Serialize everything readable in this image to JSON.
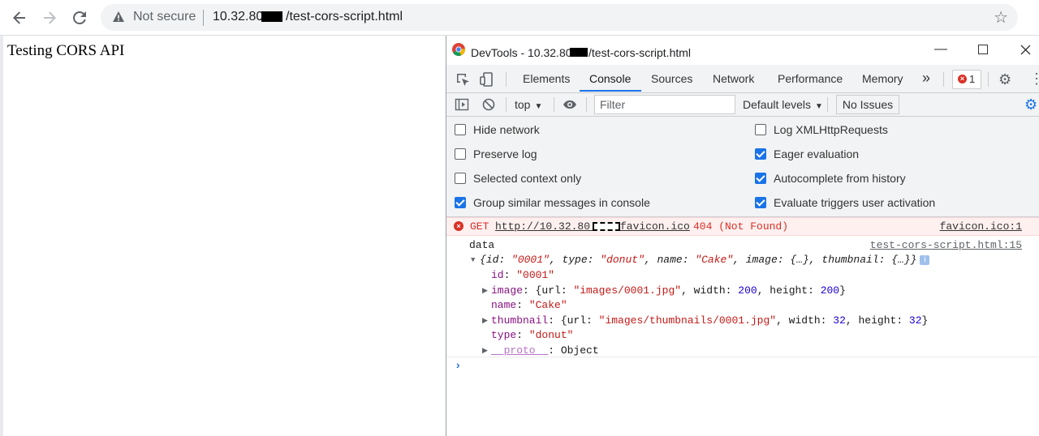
{
  "browser": {
    "security_label": "Not secure",
    "url_host": "10.32.80.",
    "url_path": "/test-cors-script.html"
  },
  "page": {
    "heading": "Testing CORS API"
  },
  "devtools": {
    "title_prefix": "DevTools - 10.32.80.",
    "title_suffix": "/test-cors-script.html",
    "tabs": [
      {
        "label": "Elements"
      },
      {
        "label": "Console"
      },
      {
        "label": "Sources"
      },
      {
        "label": "Network"
      },
      {
        "label": "Performance"
      },
      {
        "label": "Memory"
      }
    ],
    "active_tab": "Console",
    "error_count": "1",
    "toolbar": {
      "context": "top",
      "filter_placeholder": "Filter",
      "levels": "Default levels",
      "issues": "No Issues"
    },
    "settings": {
      "left": [
        {
          "label": "Hide network",
          "checked": false
        },
        {
          "label": "Preserve log",
          "checked": false
        },
        {
          "label": "Selected context only",
          "checked": false
        },
        {
          "label": "Group similar messages in console",
          "checked": true
        }
      ],
      "right": [
        {
          "label": "Log XMLHttpRequests",
          "checked": false
        },
        {
          "label": "Eager evaluation",
          "checked": true
        },
        {
          "label": "Autocomplete from history",
          "checked": true
        },
        {
          "label": "Evaluate triggers user activation",
          "checked": true
        }
      ]
    },
    "console": {
      "error": {
        "method": "GET",
        "url_start": "http://10.32.80.",
        "url_end": "favicon.ico",
        "status": "404 (Not Found)",
        "source": "favicon.ico:1"
      },
      "log_label": "data",
      "log_source": "test-cors-script.html:15",
      "object_preview": {
        "id": "\"0001\"",
        "type": "\"donut\"",
        "name": "\"Cake\"",
        "image": "{…}",
        "thumbnail": "{…}"
      },
      "props": {
        "id": "\"0001\"",
        "image_url": "\"images/0001.jpg\"",
        "image_width": "200",
        "image_height": "200",
        "name": "\"Cake\"",
        "thumb_url": "\"images/thumbnails/0001.jpg\"",
        "thumb_width": "32",
        "thumb_height": "32",
        "type": "\"donut\"",
        "proto": "Object"
      }
    }
  },
  "colors": {
    "accent": "#1a73e8",
    "error": "#d93025",
    "key": "#881280",
    "string": "#c41a16",
    "number": "#1c00cf"
  }
}
